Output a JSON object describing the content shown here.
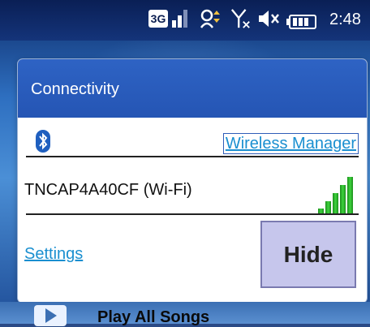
{
  "status_bar": {
    "network_badge": "3G",
    "time": "2:48",
    "icons": [
      "3g-icon",
      "signal-icon",
      "sync-icon",
      "no-antenna-icon",
      "volume-mute-icon",
      "battery-icon"
    ]
  },
  "dialog": {
    "title": "Connectivity",
    "bluetooth_icon": "bluetooth-icon",
    "wireless_manager_label": "Wireless Manager",
    "wifi_network": "TNCAP4A40CF (Wi-Fi)",
    "wifi_signal_bars": 5,
    "settings_label": "Settings",
    "hide_label": "Hide"
  },
  "background": {
    "play_all_label": "Play All Songs"
  },
  "colors": {
    "header_blue": "#2555b4",
    "link_blue": "#1a8fd0",
    "hide_button_bg": "#c6c6ec",
    "signal_green": "#3ed43e"
  }
}
